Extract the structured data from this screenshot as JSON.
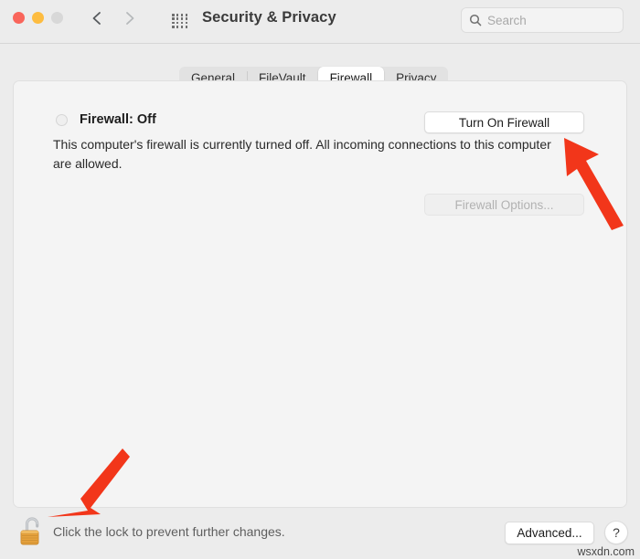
{
  "window": {
    "title": "Security & Privacy",
    "traffic_lights": {
      "close_label": "close",
      "minimize_label": "minimize",
      "zoom_label": "zoom"
    },
    "nav": {
      "back_label": "Back",
      "forward_label": "Forward"
    },
    "grid_label": "Show All",
    "search": {
      "placeholder": "Search",
      "value": ""
    }
  },
  "tabs": [
    {
      "label": "General",
      "selected": false
    },
    {
      "label": "FileVault",
      "selected": false
    },
    {
      "label": "Firewall",
      "selected": true
    },
    {
      "label": "Privacy",
      "selected": false
    }
  ],
  "firewall": {
    "status_label": "Firewall: Off",
    "status_state": "off",
    "description": "This computer's firewall is currently turned off. All incoming connections to this computer are allowed.",
    "turn_on_button": "Turn On Firewall",
    "options_button": "Firewall Options...",
    "options_disabled": true
  },
  "footer": {
    "lock_icon": "open-padlock-icon",
    "lock_state": "unlocked",
    "lock_message": "Click the lock to prevent further changes.",
    "advanced_button": "Advanced...",
    "help_button": "?"
  },
  "annotations": {
    "arrow_color": "#f2361a",
    "arrows": [
      {
        "name": "arrow-to-turn-on-firewall",
        "points_to": "Turn On Firewall"
      },
      {
        "name": "arrow-to-lock",
        "points_to": "lock icon"
      }
    ]
  },
  "watermark": "wsxdn.com"
}
